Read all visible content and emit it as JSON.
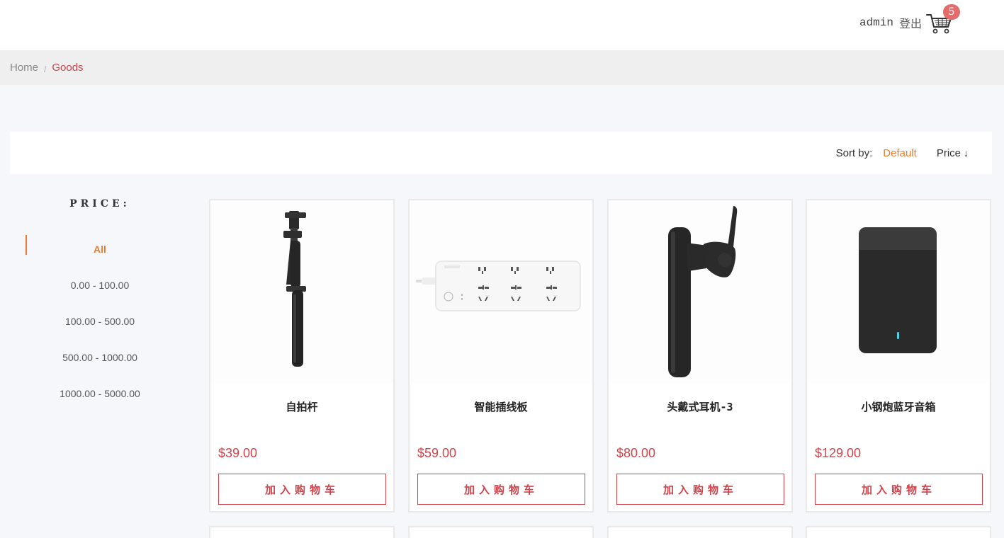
{
  "header": {
    "username": "admin",
    "logout_label": "登出",
    "cart_count": "5"
  },
  "breadcrumb": {
    "home": "Home",
    "current": "Goods"
  },
  "sort": {
    "label": "Sort by:",
    "default": "Default",
    "price": "Price",
    "price_arrow": "↓"
  },
  "filter": {
    "title": "PRICE:",
    "items": [
      {
        "label": "All",
        "active": true
      },
      {
        "label": "0.00 - 100.00"
      },
      {
        "label": "100.00 - 500.00"
      },
      {
        "label": "500.00 - 1000.00"
      },
      {
        "label": "1000.00 - 5000.00"
      }
    ]
  },
  "products": [
    {
      "name": "自拍杆",
      "price": "$39.00",
      "button": "加入购物车",
      "image_icon": "selfie-stick-image"
    },
    {
      "name": "智能插线板",
      "price": "$59.00",
      "button": "加入购物车",
      "image_icon": "power-strip-image"
    },
    {
      "name": "头戴式耳机-3",
      "price": "$80.00",
      "button": "加入购物车",
      "image_icon": "bluetooth-headset-image"
    },
    {
      "name": "小钢炮蓝牙音箱",
      "price": "$129.00",
      "button": "加入购物车",
      "image_icon": "bluetooth-speaker-image"
    }
  ],
  "colors": {
    "accent_orange": "#ee7a30",
    "price_red": "#d1434b",
    "badge": "#e36c6c"
  }
}
